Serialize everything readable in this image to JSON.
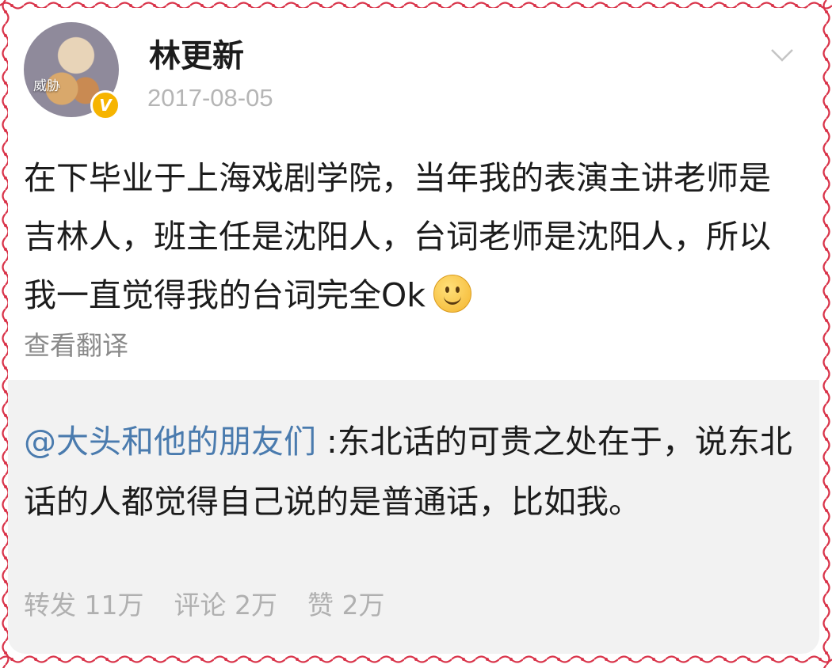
{
  "post": {
    "avatar_caption": "威胁",
    "verified_badge": "V",
    "username": "林更新",
    "date": "2017-08-05",
    "text": "在下毕业于上海戏剧学院，当年我的表演主讲老师是吉林人，班主任是沈阳人，台词老师是沈阳人，所以我一直觉得我的台词完全Ok",
    "translate_label": "查看翻译"
  },
  "repost": {
    "mention": "@大头和他的朋友们",
    "text": " :东北话的可贵之处在于，说东北话的人都觉得自己说的是普通话，比如我。",
    "stats": {
      "forward": "转发 11万",
      "comment": "评论 2万",
      "like": "赞 2万"
    }
  },
  "colors": {
    "mention": "#4a7bae",
    "border": "#d9344a",
    "repost_bg": "#f2f2f2",
    "verified": "#f6b400"
  }
}
